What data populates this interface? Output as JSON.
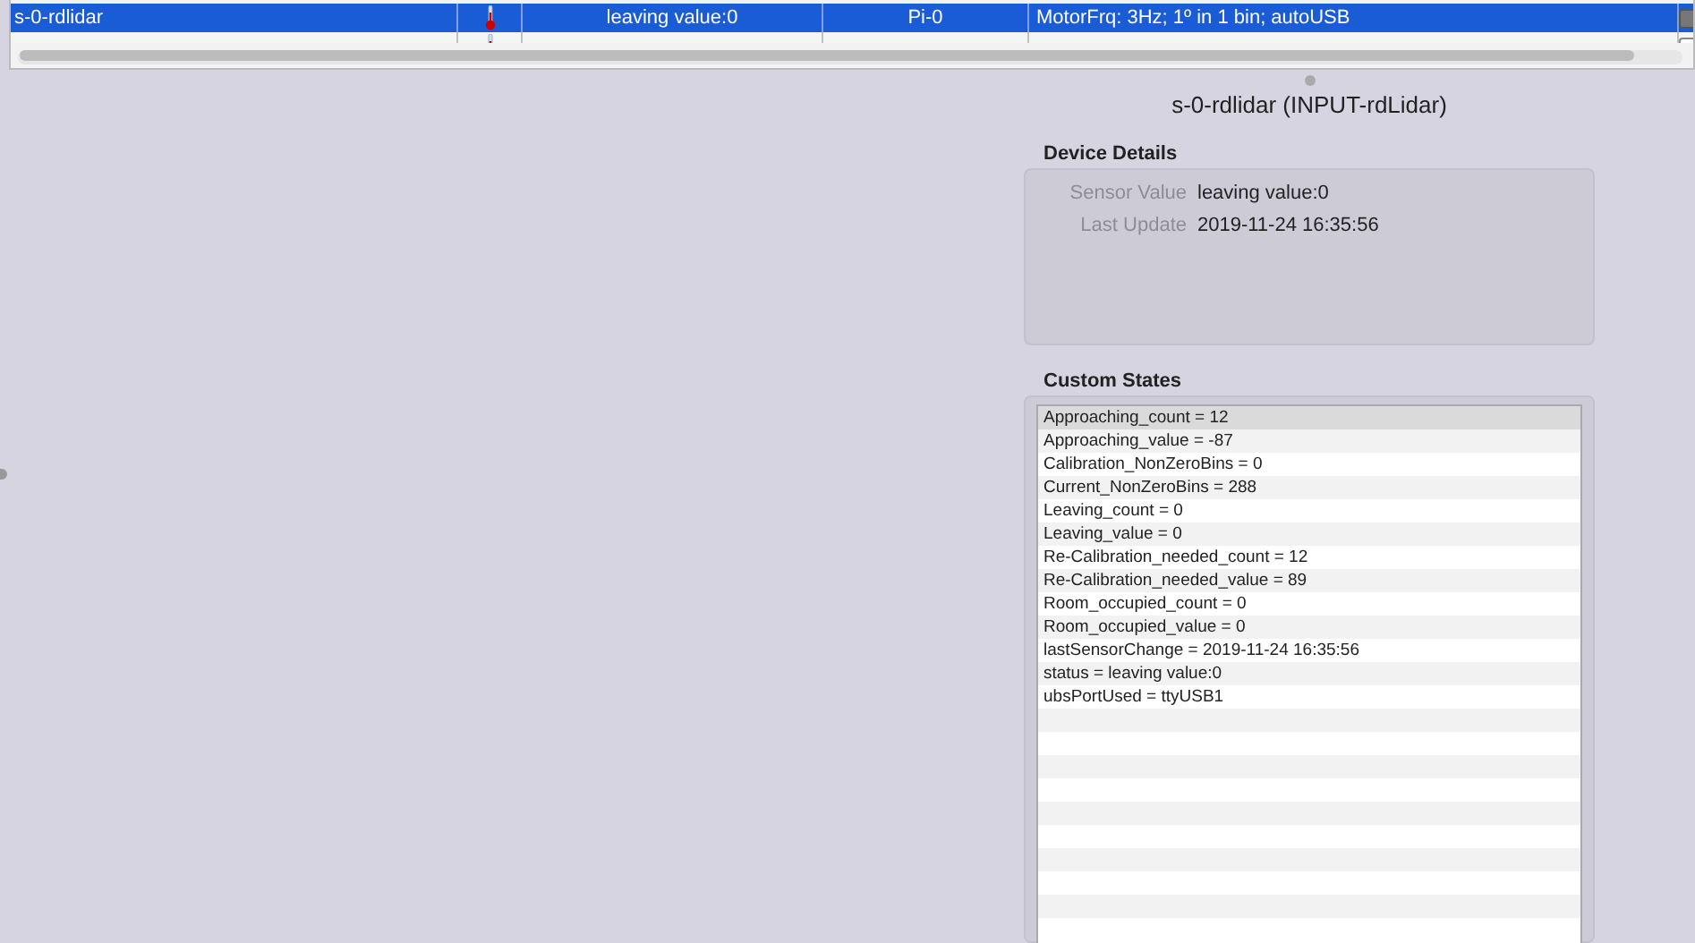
{
  "table": {
    "rows": [
      {
        "name": "s-0-rdlidar",
        "value": "leaving value:0",
        "host": "Pi-0",
        "description": "MotorFrq: 3Hz; 1º in 1 bin; autoUSB",
        "checked": true,
        "selected": true
      },
      {
        "checked": false,
        "selected": false
      }
    ]
  },
  "detail": {
    "title": "s-0-rdlidar (INPUT-rdLidar)",
    "device_details": {
      "heading": "Device Details",
      "fields": [
        {
          "label": "Sensor Value",
          "value": "leaving value:0"
        },
        {
          "label": "Last Update",
          "value": "2019-11-24 16:35:56"
        }
      ]
    },
    "custom_states": {
      "heading": "Custom States",
      "items": [
        {
          "text": "Approaching_count = 12",
          "selected": true
        },
        {
          "text": "Approaching_value = -87",
          "selected": false
        },
        {
          "text": "Calibration_NonZeroBins = 0",
          "selected": false
        },
        {
          "text": "Current_NonZeroBins = 288",
          "selected": false
        },
        {
          "text": "Leaving_count = 0",
          "selected": false
        },
        {
          "text": "Leaving_value = 0",
          "selected": false
        },
        {
          "text": "Re-Calibration_needed_count = 12",
          "selected": false
        },
        {
          "text": "Re-Calibration_needed_value = 89",
          "selected": false
        },
        {
          "text": "Room_occupied_count = 0",
          "selected": false
        },
        {
          "text": "Room_occupied_value = 0",
          "selected": false
        },
        {
          "text": "lastSensorChange = 2019-11-24 16:35:56",
          "selected": false
        },
        {
          "text": "status = leaving value:0",
          "selected": false
        },
        {
          "text": "ubsPortUsed = ttyUSB1",
          "selected": false
        }
      ]
    }
  }
}
